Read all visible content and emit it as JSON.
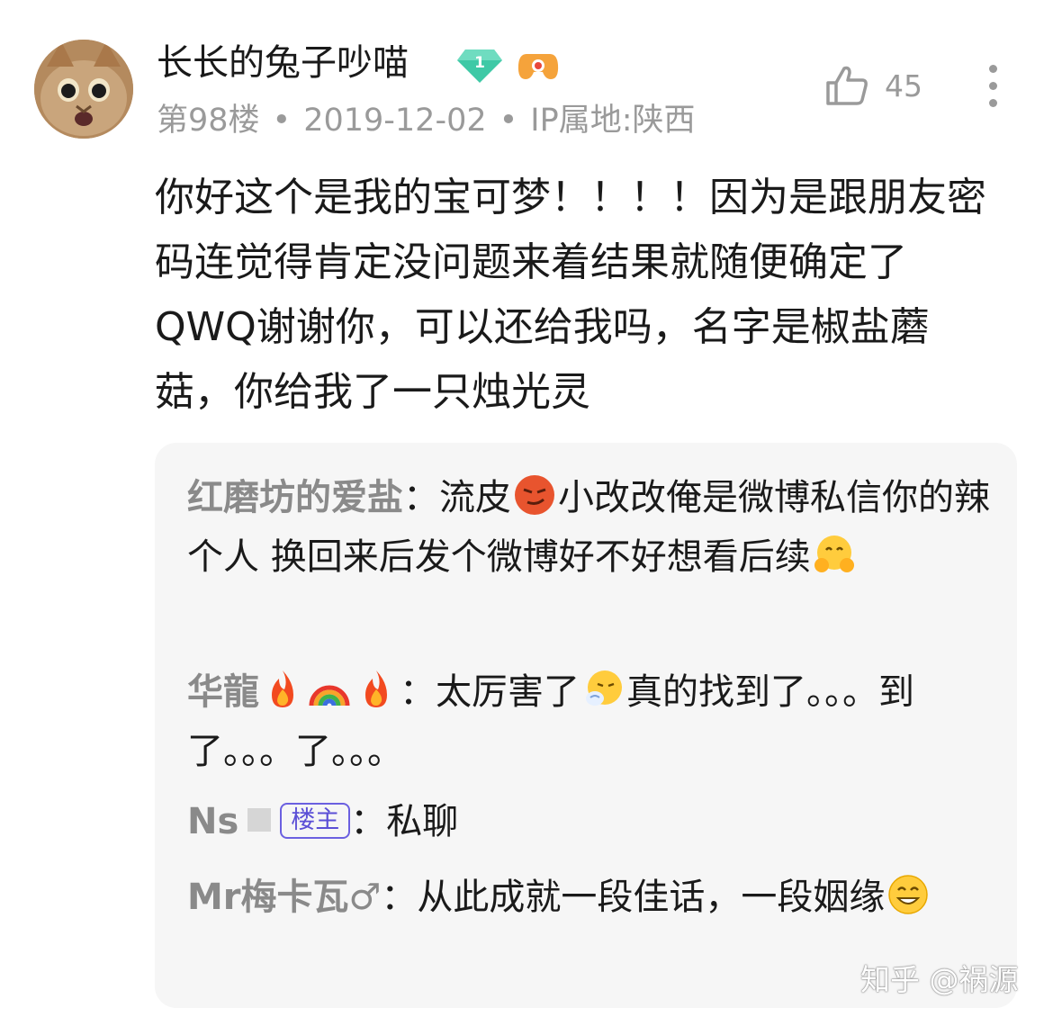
{
  "post": {
    "username": "长长的兔子吵喵",
    "badge_level": "1",
    "floor": "第98楼",
    "date": "2019-12-02",
    "ip_location": "IP属地:陕西",
    "like_count": "45",
    "content": "你好这个是我的宝可梦！！！！因为是跟朋友密码连觉得肯定没问题来着结果就随便确定了QWQ谢谢你，可以还给我吗，名字是椒盐蘑菇，你给我了一只烛光灵"
  },
  "replies": [
    {
      "author": "红磨坊的爱盐",
      "sep": "：",
      "text_a": "流皮",
      "text_b": "小改改俺是微博私信你的辣个人 换回来后发个微博好不好想看后续",
      "icons": [
        "smirk-emoji",
        "hug-emoji"
      ]
    },
    {
      "author": "华龍",
      "sep": "：",
      "text_a": "太厉害了",
      "text_b": "真的找到了。。。到了。。。了。。。",
      "icons": [
        "fire-emoji",
        "rainbow-emoji",
        "fire-emoji",
        "sneeze-emoji"
      ]
    },
    {
      "author": "Ns",
      "op_tag": "楼主",
      "sep": "：",
      "text_a": "私聊"
    },
    {
      "author": "Mr梅卡瓦♂",
      "sep": "：",
      "text_a": "从此成就一段佳话，一段姻缘",
      "icons": [
        "grin-emoji"
      ]
    }
  ],
  "watermark": "知乎 @祸源",
  "colors": {
    "reply_bg": "#f6f6f6",
    "op_tag": "#5b4fd6",
    "meta": "#9a9a9a"
  }
}
